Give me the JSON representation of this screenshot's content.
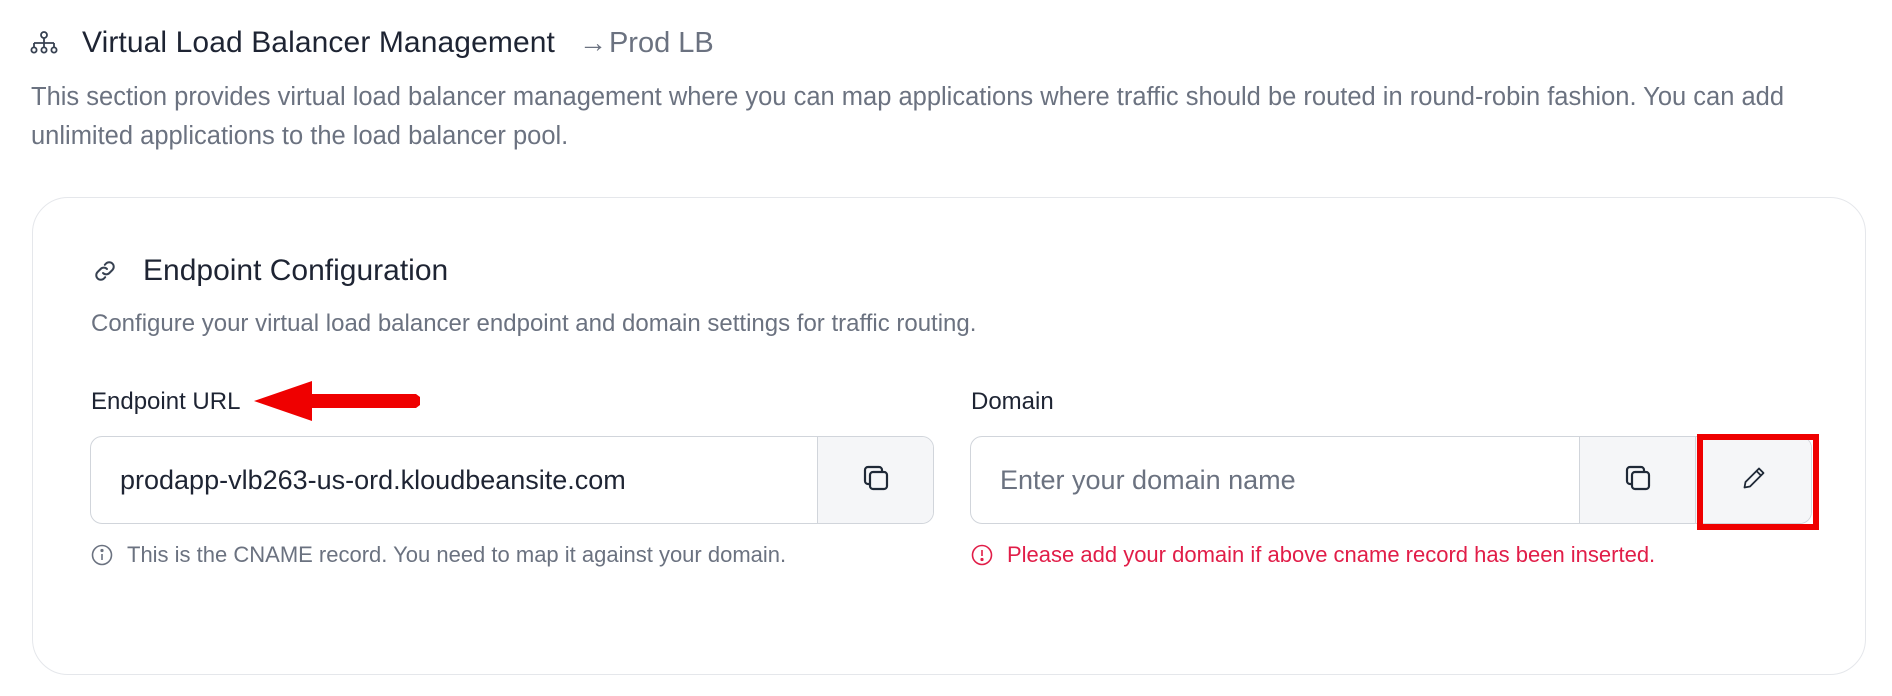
{
  "header": {
    "title": "Virtual Load Balancer Management",
    "breadcrumb_arrow": "→",
    "breadcrumb": "Prod LB",
    "icon": "sitemap-icon"
  },
  "description": "This section provides virtual load balancer management where you can map applications where traffic should be routed in round-robin fashion. You can add unlimited applications to the load balancer pool.",
  "card": {
    "title": "Endpoint Configuration",
    "icon": "link-icon",
    "description": "Configure your virtual load balancer endpoint and domain settings for traffic routing."
  },
  "endpoint": {
    "label": "Endpoint URL",
    "value": "prodapp-vlb263-us-ord.kloudbeansite.com",
    "helper": "This is the CNAME record. You need to map it against your domain.",
    "copy_icon": "copy-icon"
  },
  "domain": {
    "label": "Domain",
    "value": "",
    "placeholder": "Enter your domain name",
    "helper": "Please add your domain if above cname record has been inserted.",
    "copy_icon": "copy-icon",
    "edit_icon": "pencil-icon"
  },
  "colors": {
    "error": "#e11d48",
    "annotation": "#ef0000",
    "muted": "#6b7280",
    "heading": "#1e2433"
  }
}
